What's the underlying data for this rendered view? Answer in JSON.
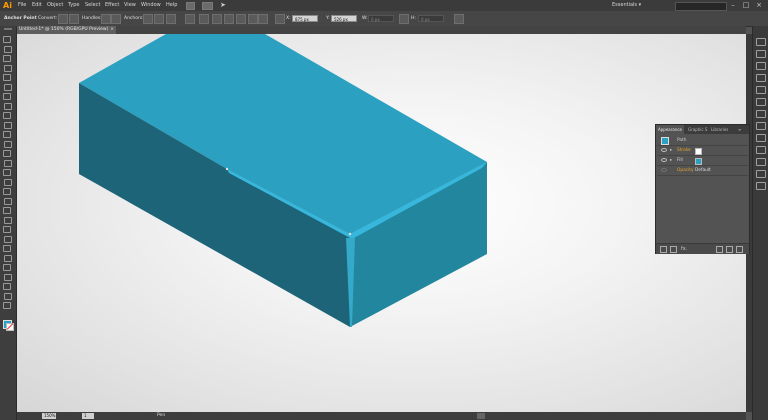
{
  "app": {
    "logo": "Ai"
  },
  "menu": [
    "File",
    "Edit",
    "Object",
    "Type",
    "Select",
    "Effect",
    "View",
    "Window",
    "Help"
  ],
  "workspace": {
    "label": "Essentials ▾"
  },
  "control": {
    "tool_label": "Anchor Point",
    "convert_label": "Convert:",
    "handles_label": "Handles:",
    "anchors_label": "Anchors:",
    "x_label": "X:",
    "x_value": "875 px",
    "y_label": "Y:",
    "y_value": "526 px",
    "w_label": "W:",
    "w_value": "0 px",
    "h_label": "H:",
    "h_value": "0 px"
  },
  "doc_tab": {
    "title": "Untitled-1* @ 150% (RGB/GPU Preview)",
    "close": "×"
  },
  "status": {
    "zoom": "150%",
    "page": "1",
    "tool": "Pen"
  },
  "appearance": {
    "tabs": [
      "Appearance",
      "Graphic S",
      "Libraries"
    ],
    "header": "Path",
    "rows": [
      {
        "name": "Stroke",
        "value": ""
      },
      {
        "name": "Fill",
        "value": ""
      },
      {
        "name": "Opacity",
        "value": "Default"
      }
    ],
    "menu_icon": "≡"
  },
  "colors": {
    "fill": "#2ba0c0",
    "top_face": "#2ba0c0",
    "left_face": "#1d6479",
    "right_face": "#22869f",
    "highlight": "#38b7dc"
  },
  "icons": [
    "ai-logo",
    "bridge-icon",
    "arrange-icon",
    "send-icon",
    "selection-tool-icon",
    "pen-tool-icon",
    "eye-icon",
    "new-art-icon",
    "trash-icon"
  ]
}
